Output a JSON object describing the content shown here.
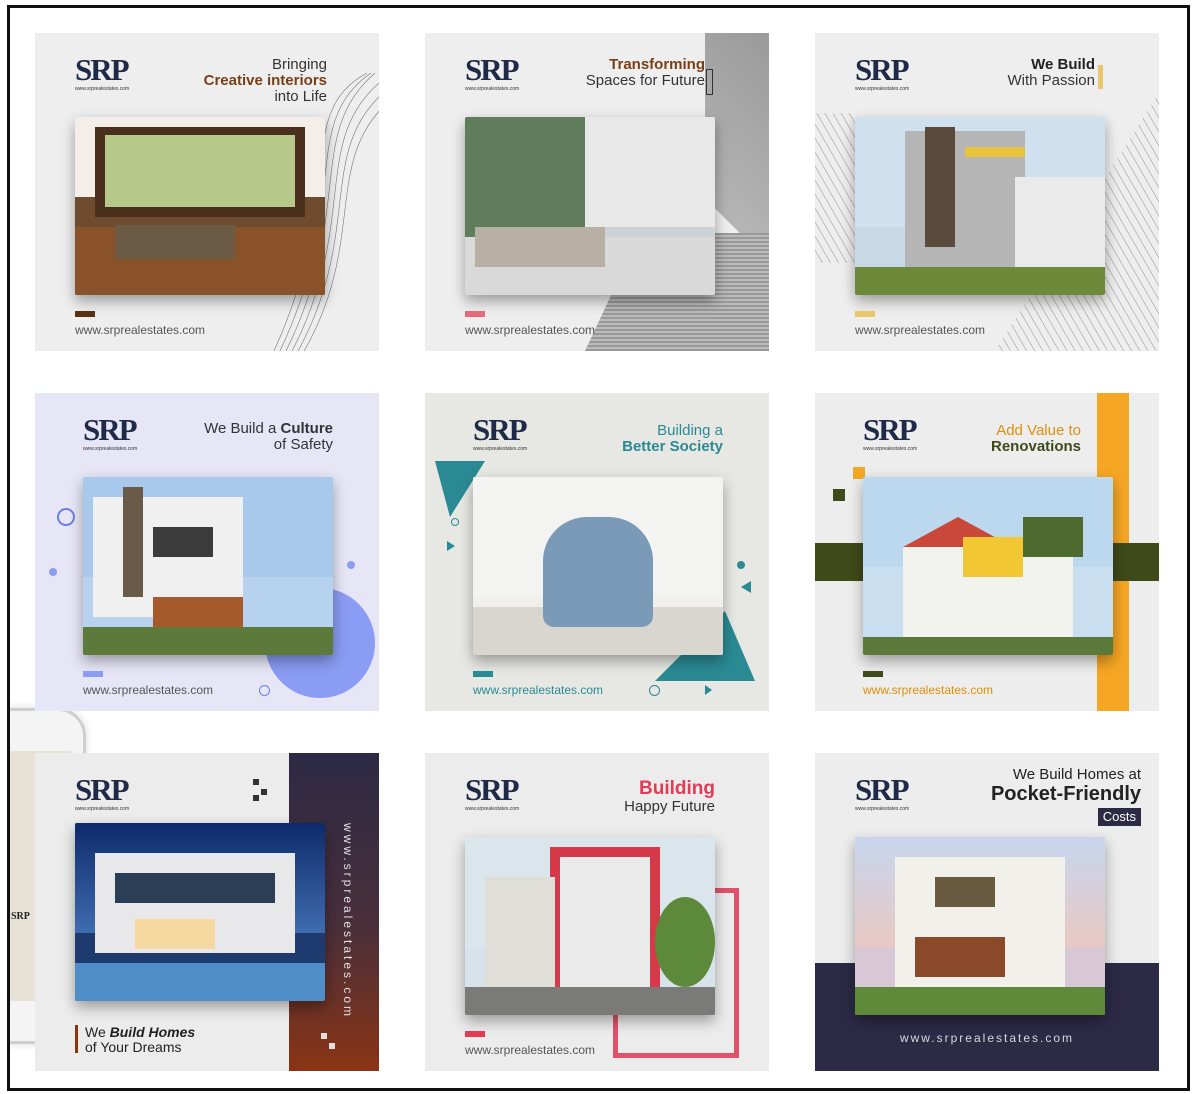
{
  "brand": {
    "logo_text": "SRP",
    "logo_url": "www.srprealestates.com",
    "website": "www.srprealestates.com",
    "website_spaced": "www.srprealestates.com"
  },
  "cards": [
    {
      "head_line1": "Bringing",
      "head_line2": "Creative interiors",
      "head_line3": "into Life",
      "accent": "#5a3213"
    },
    {
      "head_line1": "Transforming",
      "head_line2": "Spaces for Future",
      "accent": "#e26a7a"
    },
    {
      "head_line1": "We Build",
      "head_line2": "With Passion",
      "accent": "#e8c66b"
    },
    {
      "head_line1": "We Build a",
      "head_line1_bold": "Culture",
      "head_line2": "of Safety",
      "accent": "#8b9cf4"
    },
    {
      "head_line1": "Building a",
      "head_line2": "Better Society",
      "accent": "#2a8a94"
    },
    {
      "head_line1": "Add Value to",
      "head_line2": "Renovations",
      "accent": "#f5a623"
    },
    {
      "head_line1": "We",
      "head_line1_bold": "Build Homes",
      "head_line2": "of Your Dreams",
      "accent": "#8a3414"
    },
    {
      "head_line1": "Building",
      "head_line2": "Happy Future",
      "accent": "#e03c54"
    },
    {
      "head_line1": "We Build Homes at",
      "head_line2": "Pocket-Friendly",
      "head_line3": "Costs",
      "accent": "#2c2a45"
    }
  ],
  "icons": {
    "phone": "phone-mockup",
    "circle": "circle-outline-icon",
    "triangle": "play-triangle-icon"
  }
}
